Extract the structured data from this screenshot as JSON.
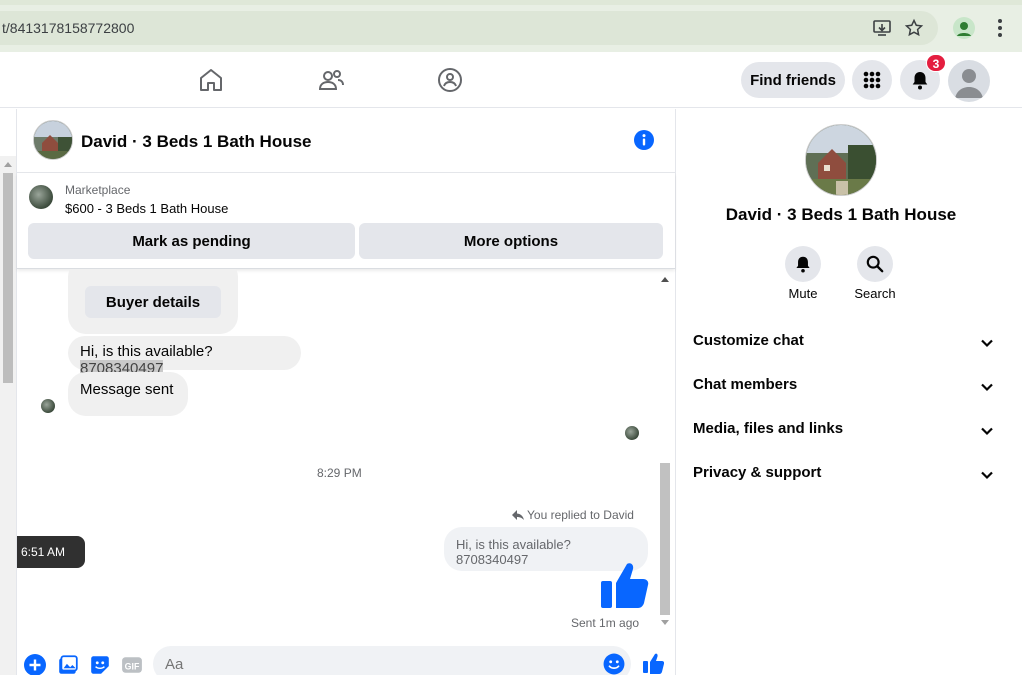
{
  "browser": {
    "url": "t/8413178158772800"
  },
  "nav": {
    "find_friends": "Find friends",
    "notification_count": "3"
  },
  "chat": {
    "title": "David · 3 Beds 1 Bath House",
    "marketplace_label": "Marketplace",
    "listing": "$600 - 3 Beds 1 Bath House",
    "mark_pending": "Mark as pending",
    "more_options": "More options",
    "buyer_details": "Buyer details",
    "msg1_text": "Hi, is this available?",
    "msg1_phone": "8708340497",
    "msg2": "Message sent",
    "tooltip_time": "6:51 AM",
    "time_separator": "8:29 PM",
    "replied_label": "You replied to David",
    "reply_quote": "Hi, is this available?8708340497",
    "sent_status": "Sent 1m ago",
    "composer_placeholder": "Aa"
  },
  "right_panel": {
    "title": "David · 3 Beds 1 Bath House",
    "mute": "Mute",
    "search": "Search",
    "rows": [
      "Customize chat",
      "Chat members",
      "Media, files and links",
      "Privacy & support"
    ]
  },
  "colors": {
    "accent": "#0866ff",
    "badge": "#e41e3f"
  }
}
